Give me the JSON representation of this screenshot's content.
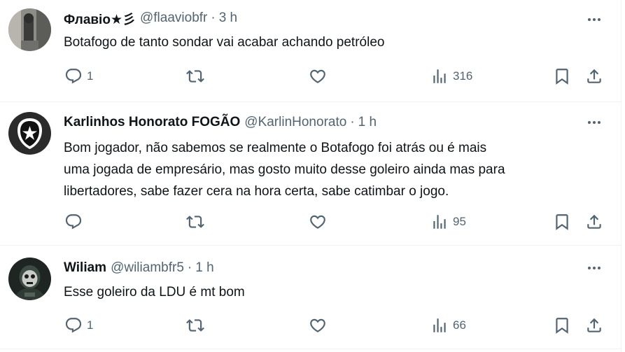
{
  "tweets": [
    {
      "name": "Флавіо★彡",
      "handle": "@flaaviobfr",
      "time": "3 h",
      "lines": [
        "Botafogo de tanto sondar vai acabar achando petróleo"
      ],
      "replies": "1",
      "reposts": "",
      "likes": "",
      "views": "316"
    },
    {
      "name": "Karlinhos Honorato FOGÃO",
      "handle": "@KarlinHonorato",
      "time": "1 h",
      "lines": [
        "Bom jogador, não sabemos se realmente o Botafogo foi atrás ou é mais",
        "uma jogada de empresário, mas gosto muito desse goleiro ainda mas para",
        "libertadores, sabe fazer cera na hora certa, sabe catimbar o jogo."
      ],
      "replies": "",
      "reposts": "",
      "likes": "",
      "views": "95"
    },
    {
      "name": "Wiliam",
      "handle": "@wiliambfr5",
      "time": "1 h",
      "lines": [
        "Esse goleiro da LDU é mt bom"
      ],
      "replies": "1",
      "reposts": "",
      "likes": "",
      "views": "66"
    }
  ],
  "separator": "·",
  "icons": {
    "more": "more-dots-icon",
    "reply": "reply-icon",
    "repost": "repost-icon",
    "like": "like-icon",
    "views": "views-icon",
    "bookmark": "bookmark-icon",
    "share": "share-icon"
  },
  "colors": {
    "text": "#0f1419",
    "secondary": "#536471",
    "border": "#eff3f4"
  }
}
